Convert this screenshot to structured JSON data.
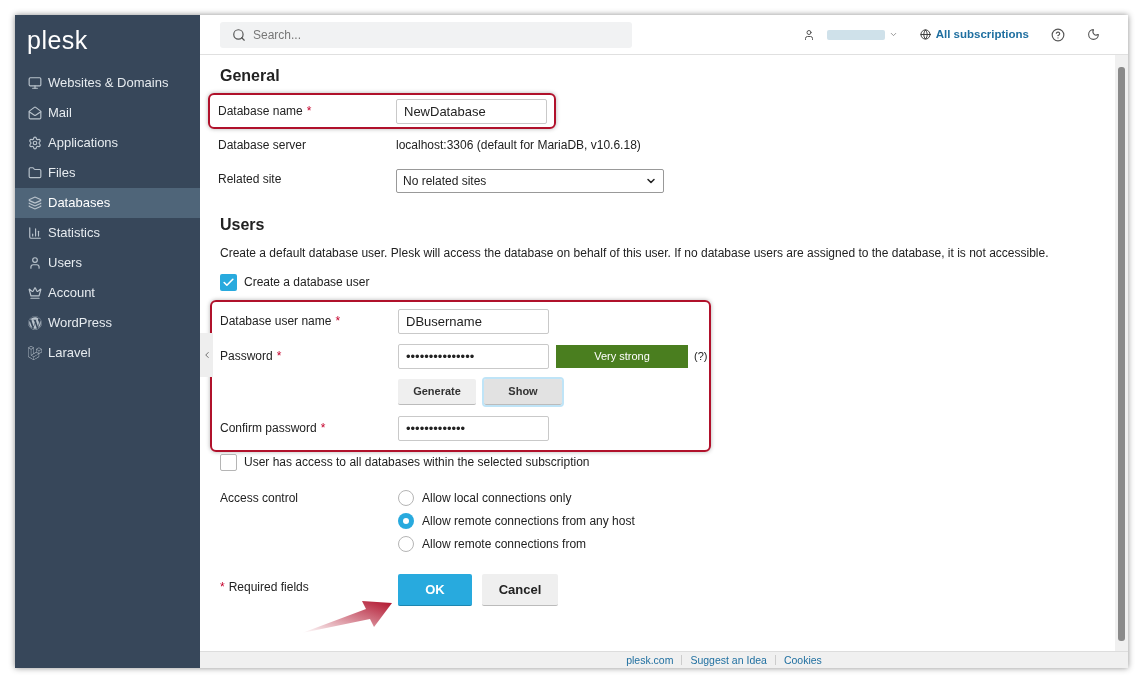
{
  "required_mark": "*",
  "sidebar": {
    "logo": "plesk",
    "items": [
      {
        "label": "Websites & Domains",
        "selected": false
      },
      {
        "label": "Mail",
        "selected": false
      },
      {
        "label": "Applications",
        "selected": false
      },
      {
        "label": "Files",
        "selected": false
      },
      {
        "label": "Databases",
        "selected": true
      },
      {
        "label": "Statistics",
        "selected": false
      },
      {
        "label": "Users",
        "selected": false
      },
      {
        "label": "Account",
        "selected": false
      },
      {
        "label": "WordPress",
        "selected": false
      },
      {
        "label": "Laravel",
        "selected": false
      }
    ]
  },
  "topbar": {
    "search": {
      "placeholder": "Search..."
    },
    "subscriptions": "All subscriptions"
  },
  "general": {
    "heading": "General",
    "highlighted": true,
    "fields": [
      {
        "kind": "input",
        "label": "Database name",
        "required": true,
        "value": "NewDatabase"
      },
      {
        "kind": "text",
        "label": "Database server",
        "required": false,
        "value": "localhost:3306 (default for MariaDB, v10.6.18)"
      },
      {
        "kind": "select",
        "label": "Related site",
        "required": false,
        "value": "No related sites"
      }
    ]
  },
  "users": {
    "heading": "Users",
    "description": "Create a default database user. Plesk will access the database on behalf of this user. If no database users are assigned to the database, it is not accessible.",
    "create_user": {
      "label": "Create a database user",
      "checked": true
    },
    "highlighted": true,
    "user_name": {
      "label": "Database user name",
      "required": true,
      "value": "DBusername"
    },
    "password": {
      "label": "Password",
      "required": true,
      "value": "•••••••••••••••",
      "strength": "Very strong",
      "hint": "(?)"
    },
    "password_buttons": [
      {
        "label": "Generate",
        "focused": false
      },
      {
        "label": "Show",
        "focused": true
      }
    ],
    "confirm": {
      "label": "Confirm password",
      "required": true,
      "value": "•••••••••••••"
    },
    "access_all": {
      "label": "User has access to all databases within the selected subscription",
      "checked": false
    },
    "access_control": {
      "label": "Access control",
      "options": [
        {
          "label": "Allow local connections only",
          "selected": false
        },
        {
          "label": "Allow remote connections from any host",
          "selected": true
        },
        {
          "label": "Allow remote connections from",
          "selected": false
        }
      ]
    }
  },
  "actions": {
    "required_note": "Required fields",
    "ok": "OK",
    "cancel": "Cancel",
    "arrow_to_ok": true
  },
  "footer": {
    "links": [
      "plesk.com",
      "Suggest an Idea",
      "Cookies"
    ]
  }
}
